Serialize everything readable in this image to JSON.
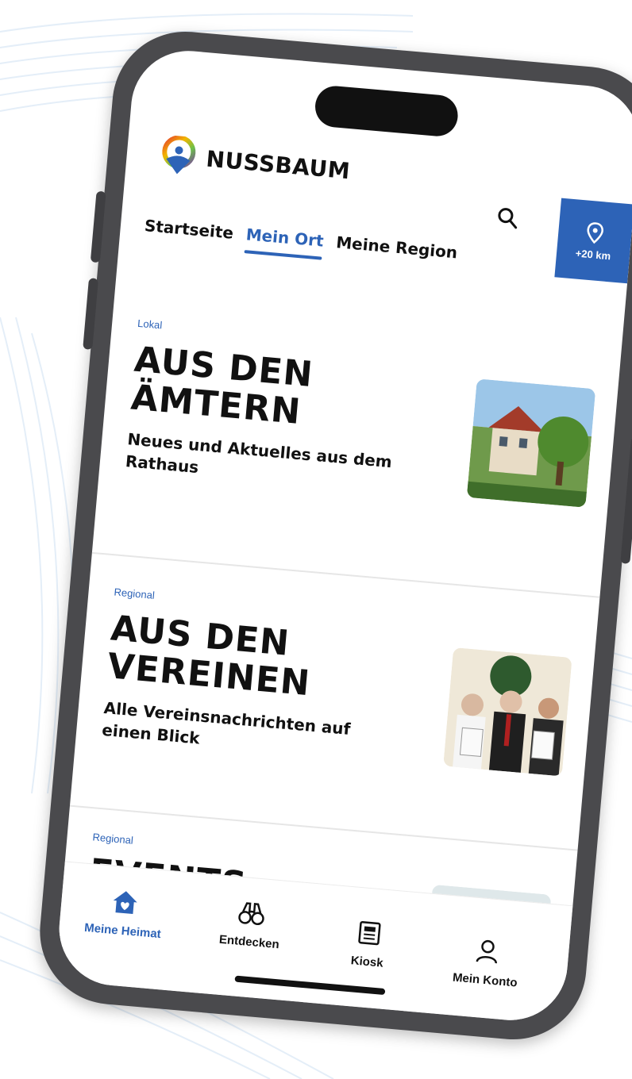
{
  "brand": {
    "name": "NUSSBAUM"
  },
  "header": {
    "radius_label": "+20 km"
  },
  "tabs": [
    {
      "label": "Startseite",
      "active": false
    },
    {
      "label": "Mein Ort",
      "active": true
    },
    {
      "label": "Meine Region",
      "active": false
    }
  ],
  "cards": [
    {
      "category": "Lokal",
      "title": "AUS DEN ÄMTERN",
      "subtitle": "Neues und Aktuelles aus dem Rathaus"
    },
    {
      "category": "Regional",
      "title": "AUS DEN VEREINEN",
      "subtitle": "Alle Vereinsnachrichten auf einen Blick"
    },
    {
      "category": "Regional",
      "title": "EVENTS",
      "subtitle": ""
    }
  ],
  "bottom_nav": [
    {
      "label": "Meine Heimat",
      "icon": "home-heart-icon",
      "active": true
    },
    {
      "label": "Entdecken",
      "icon": "binoculars-icon",
      "active": false
    },
    {
      "label": "Kiosk",
      "icon": "newspaper-icon",
      "active": false
    },
    {
      "label": "Mein Konto",
      "icon": "user-icon",
      "active": false
    }
  ],
  "colors": {
    "accent": "#2d63b7",
    "frame": "#4a4a4d"
  }
}
